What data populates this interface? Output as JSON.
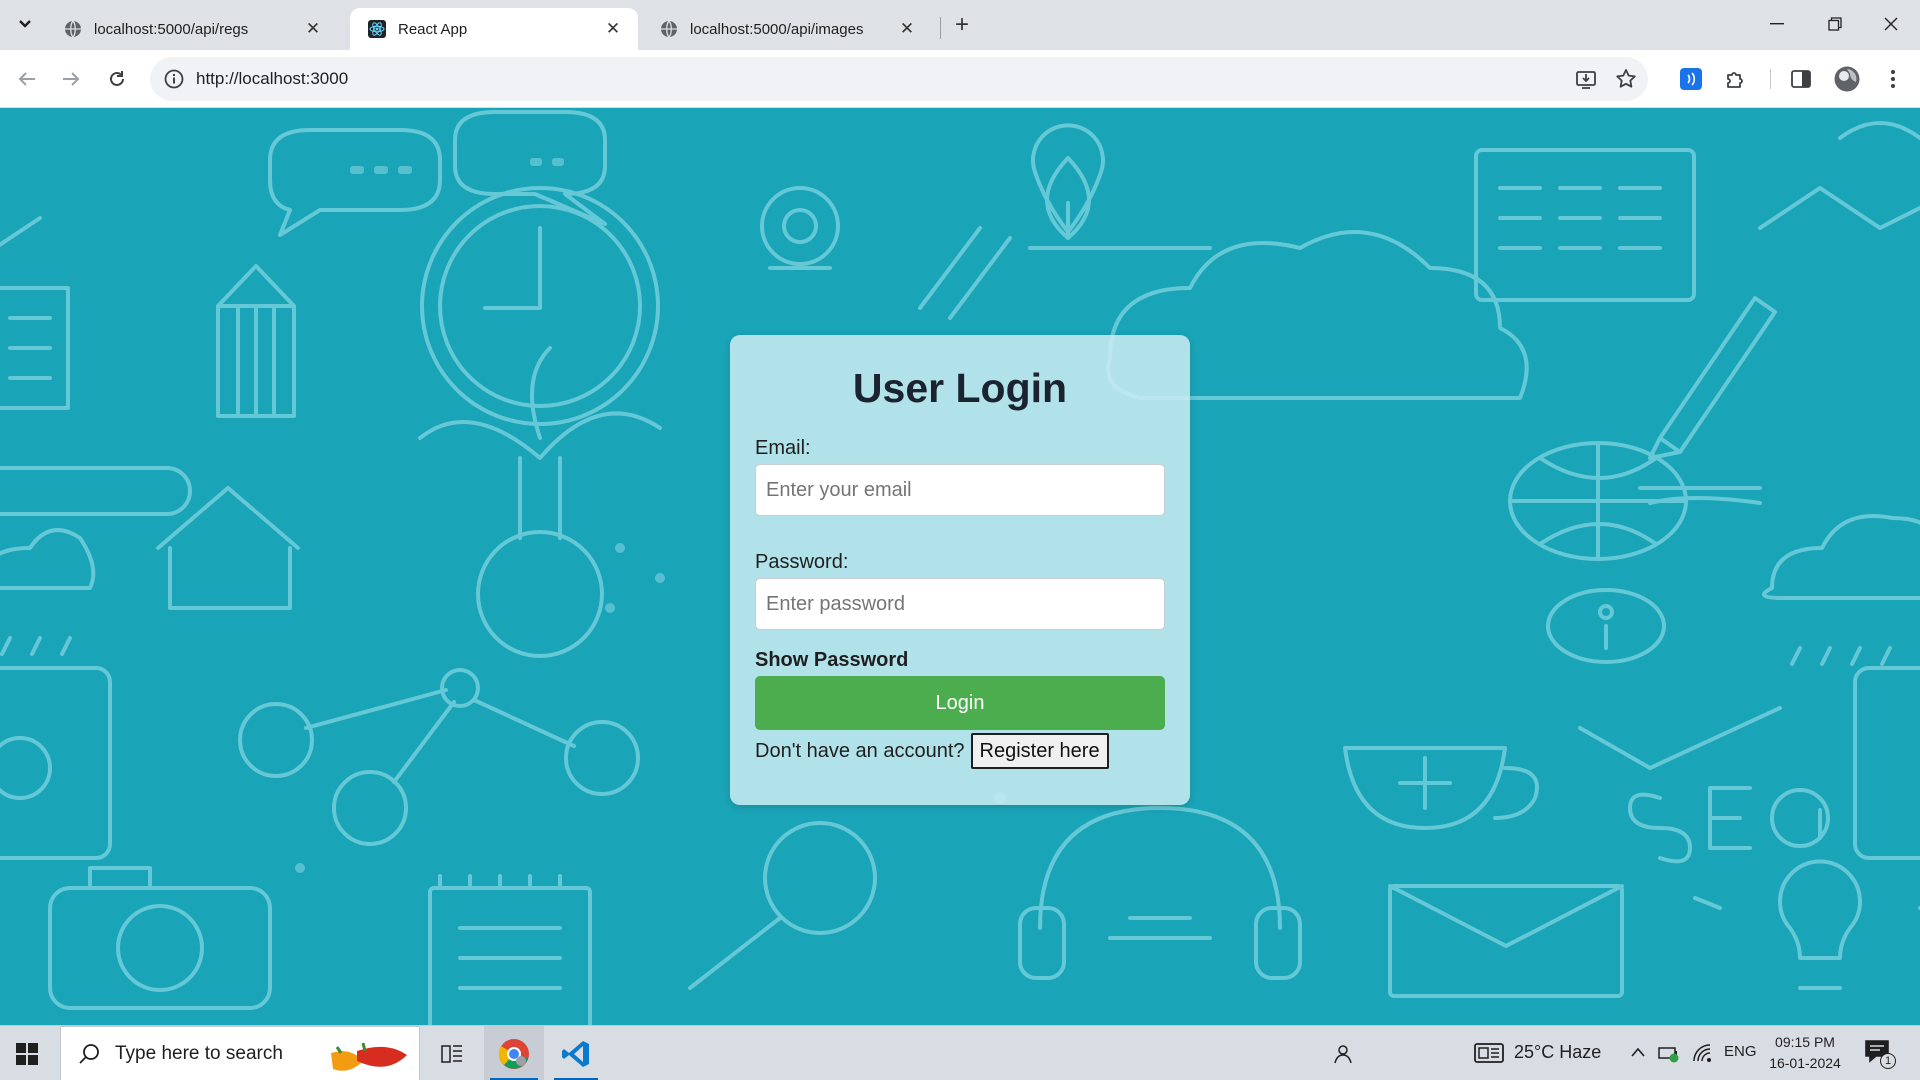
{
  "browser": {
    "tabs": [
      {
        "title": "localhost:5000/api/regs",
        "active": false,
        "favicon": "globe-icon"
      },
      {
        "title": "React App",
        "active": true,
        "favicon": "react-icon"
      },
      {
        "title": "localhost:5000/api/images",
        "active": false,
        "favicon": "globe-icon"
      }
    ],
    "url": "http://localhost:3000"
  },
  "login": {
    "title": "User Login",
    "email_label": "Email:",
    "email_placeholder": "Enter your email",
    "password_label": "Password:",
    "password_placeholder": "Enter password",
    "show_password": "Show Password",
    "login_button": "Login",
    "no_account_text": "Don't have an account?",
    "register_button": "Register here"
  },
  "taskbar": {
    "search_placeholder": "Type here to search",
    "weather": "25°C  Haze",
    "language": "ENG",
    "time": "09:15 PM",
    "date": "16-01-2024",
    "notification_count": "1"
  },
  "colors": {
    "page_background": "#1aa4b8",
    "login_button": "#4cad4f",
    "card_background": "#cbecf2"
  }
}
